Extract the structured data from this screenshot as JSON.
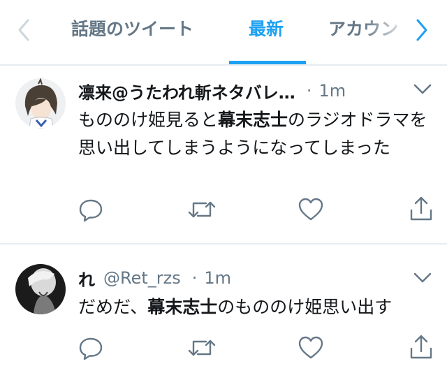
{
  "tabs": [
    {
      "label": "話題のツイート"
    },
    {
      "label": "最新"
    },
    {
      "label": "アカウン"
    }
  ],
  "colors": {
    "accent": "#1da1f2",
    "text": "#14171a",
    "muted": "#657786",
    "divider": "#e6ecf0"
  },
  "tweets": [
    {
      "name": "凛来@うたわれ斬ネタバレ…",
      "handle": "",
      "sep": "·",
      "time": "1m",
      "text_pre": "もののけ姫見ると",
      "text_bold": "幕末志士",
      "text_post": "のラジオドラマを思い出してしまうようになってしまった"
    },
    {
      "name": "れ",
      "handle": "@Ret_rzs",
      "sep": "·",
      "time": "1m",
      "text_pre": "だめだ、",
      "text_bold": "幕末志士",
      "text_post": "のもののけ姫思い出す"
    }
  ],
  "icons": [
    "chevron-left-icon",
    "chevron-right-icon",
    "chevron-down-icon",
    "reply-icon",
    "retweet-icon",
    "like-icon",
    "share-icon"
  ]
}
